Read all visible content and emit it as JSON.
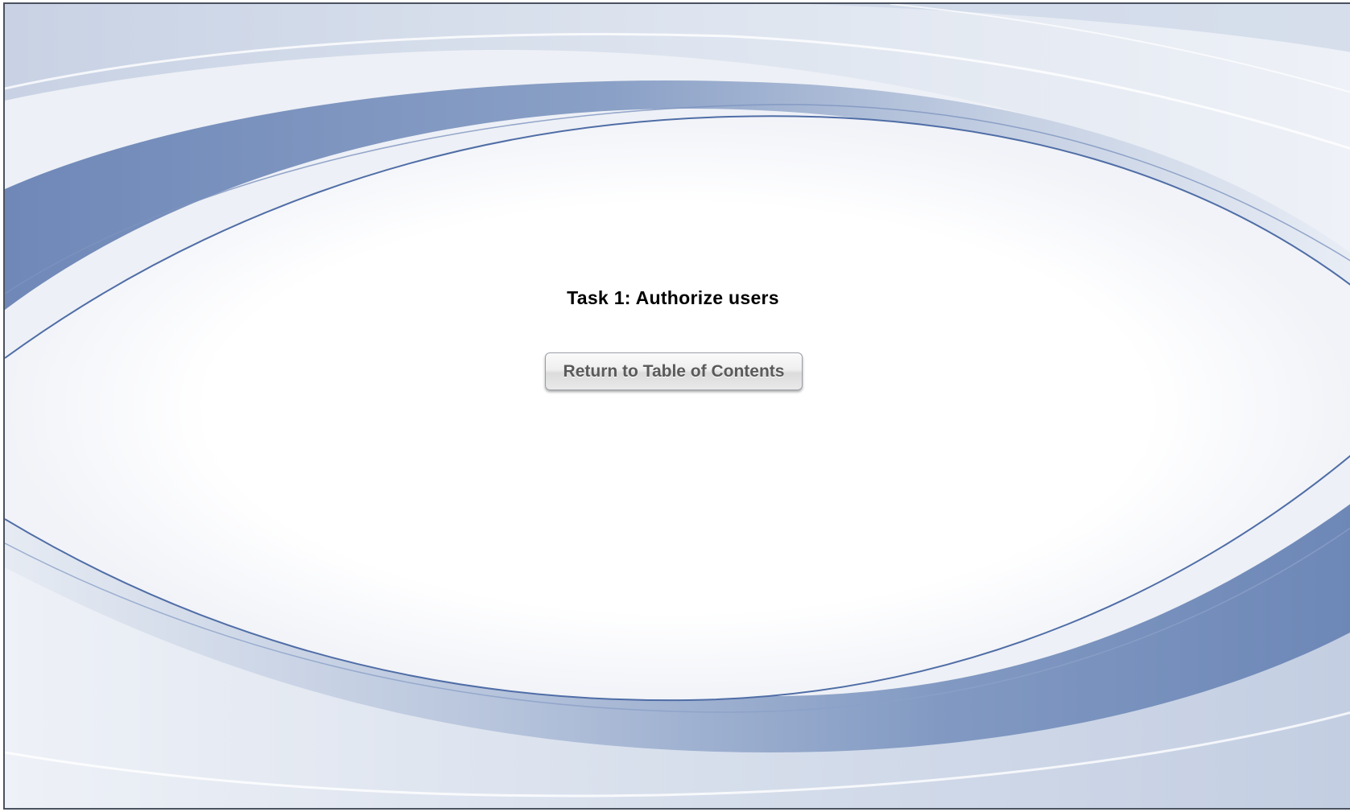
{
  "page": {
    "title": "Task 1: Authorize users"
  },
  "navigation": {
    "return_button_label": "Return to Table of Contents"
  },
  "colors": {
    "band_dark": "#6f8ab8",
    "band_mid": "#a9b7d3",
    "band_light": "#dbe2ee",
    "line_accent": "#4f6da6",
    "border": "#4a5260"
  }
}
